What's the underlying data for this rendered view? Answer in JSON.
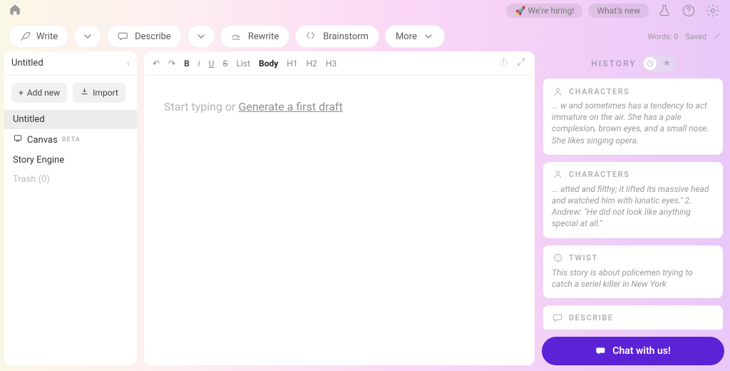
{
  "top": {
    "hiring": "🚀 We're hiring!",
    "whatsnew": "What's new"
  },
  "toolbar": {
    "write": "Write",
    "describe": "Describe",
    "rewrite": "Rewrite",
    "brainstorm": "Brainstorm",
    "more": "More"
  },
  "status": {
    "words": "Words: 0",
    "saved": "Saved"
  },
  "sidebar": {
    "doc_title": "Untitled",
    "add_new": "Add new",
    "import": "Import",
    "items": [
      {
        "label": "Untitled",
        "active": true
      },
      {
        "label": "Canvas",
        "beta": "BETA"
      },
      {
        "label": "Story Engine"
      },
      {
        "label": "Trash (0)",
        "muted": true
      }
    ]
  },
  "editor": {
    "fmt": {
      "bold": "B",
      "italic": "i",
      "underline": "U",
      "strike": "S",
      "list": "List",
      "body": "Body",
      "h1": "H1",
      "h2": "H2",
      "h3": "H3"
    },
    "placeholder_pre": "Start typing or ",
    "placeholder_link": "Generate a first draft"
  },
  "history": {
    "title": "HISTORY",
    "cards": [
      {
        "kind": "CHARACTERS",
        "icon": "person",
        "body": "... w and sometimes has a tendency to act immature on the air. She has a pale complexion, brown eyes, and a small nose. She likes singing opera."
      },
      {
        "kind": "CHARACTERS",
        "icon": "person",
        "body": "... atted and filthy; it lifted its massive head and watched him with lunatic eyes.\" 2. Andrew: \"He did not look like anything special at all.\""
      },
      {
        "kind": "TWIST",
        "icon": "face",
        "body": "This story is about policemen trying to catch a seriel killer in New York"
      },
      {
        "kind": "DESCRIBE",
        "icon": "chat",
        "body": ""
      }
    ]
  },
  "chat_label": "Chat with us!"
}
